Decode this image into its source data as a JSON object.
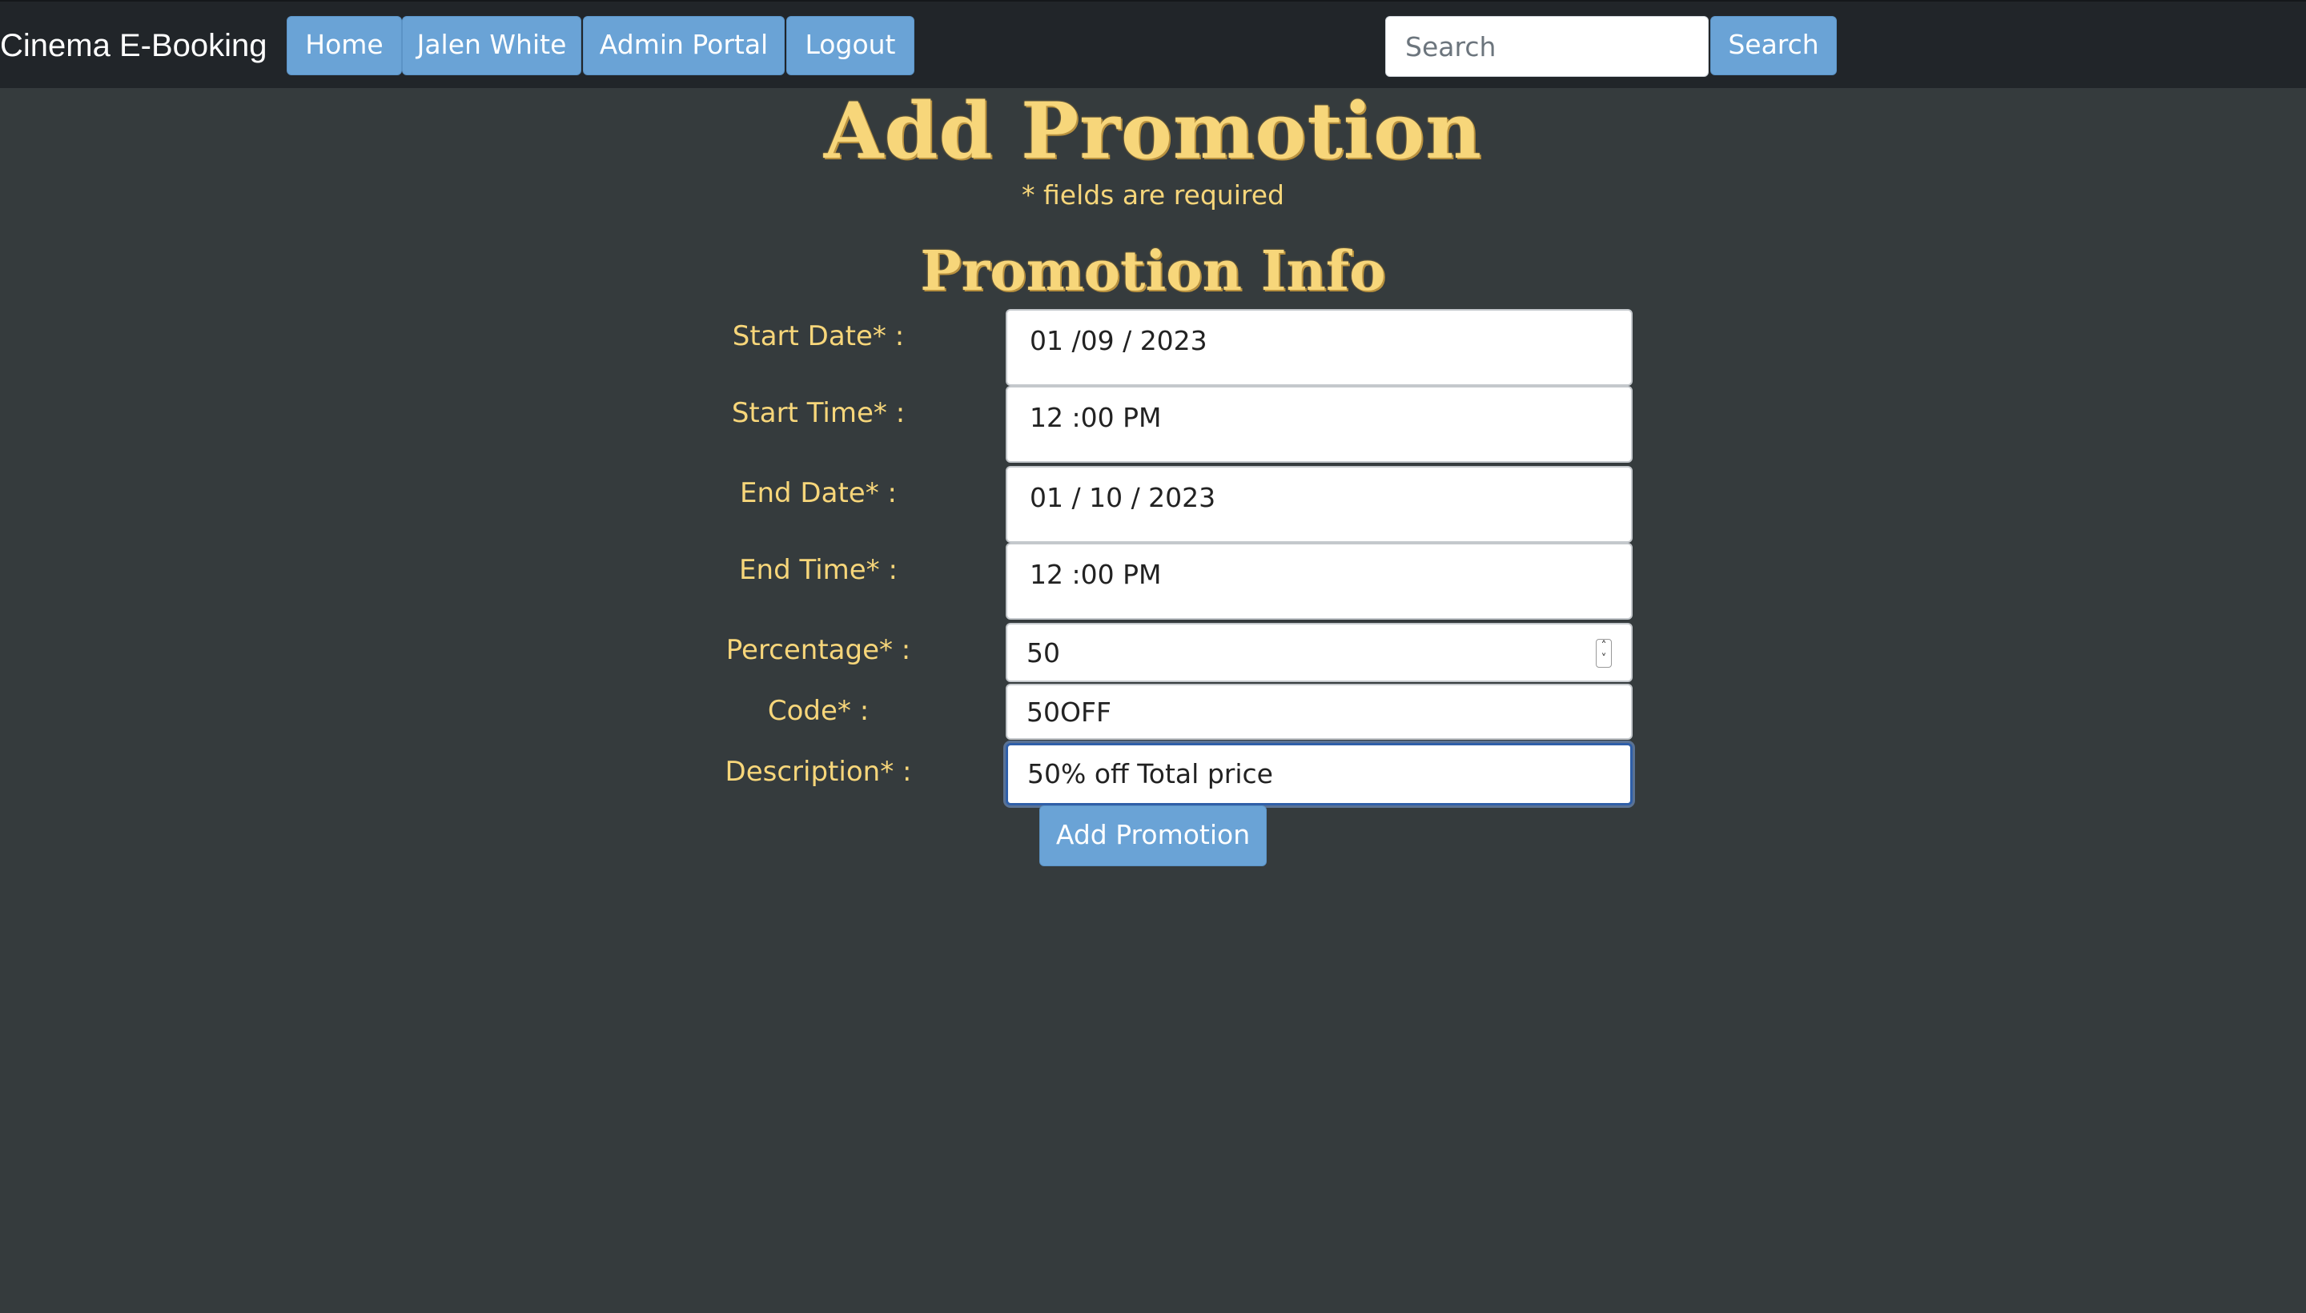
{
  "navbar": {
    "brand": "Cinema E-Booking",
    "links": [
      "Home",
      "Jalen White",
      "Admin Portal",
      "Logout"
    ],
    "search_placeholder": "Search",
    "search_button": "Search"
  },
  "page": {
    "title": "Add Promotion",
    "required_note": "* fields are required",
    "section_title": "Promotion Info"
  },
  "form": {
    "start_date": {
      "label": "Start Date* :",
      "value": "01 /09 / 2023"
    },
    "start_time": {
      "label": "Start Time* :",
      "value": "12 :00 PM"
    },
    "end_date": {
      "label": "End Date* :",
      "value": "01 / 10 / 2023"
    },
    "end_time": {
      "label": "End Time* :",
      "value": "12 :00 PM"
    },
    "percentage": {
      "label": "Percentage* :",
      "value": "50"
    },
    "code": {
      "label": "Code* :",
      "value": "50OFF"
    },
    "description": {
      "label": "Description* :",
      "value": "50% off Total price"
    },
    "submit_label": "Add Promotion"
  },
  "colors": {
    "background": "#353b3d",
    "navbar": "#212529",
    "accent": "#f7d67a",
    "button": "#6aa3d6"
  }
}
